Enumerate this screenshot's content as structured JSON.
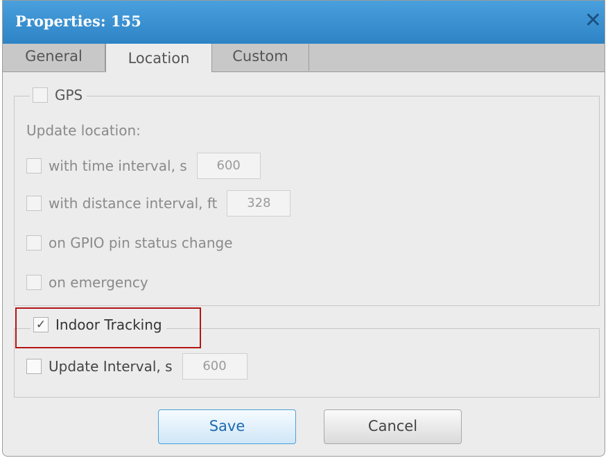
{
  "window": {
    "title": "Properties: 155",
    "close_glyph": "✕"
  },
  "tabs": [
    {
      "label": "General",
      "active": false
    },
    {
      "label": "Location",
      "active": true
    },
    {
      "label": "Custom",
      "active": false
    }
  ],
  "gps": {
    "label": "GPS",
    "checked": false,
    "update_location_label": "Update location:",
    "options": [
      {
        "label": "with time interval, s",
        "checked": false,
        "value": "600"
      },
      {
        "label": "with distance interval, ft",
        "checked": false,
        "value": "328"
      },
      {
        "label": "on GPIO pin status change",
        "checked": false
      },
      {
        "label": "on emergency",
        "checked": false
      }
    ]
  },
  "indoor": {
    "label": "Indoor Tracking",
    "checked": true,
    "check_glyph": "✓",
    "update_interval_label": "Update Interval, s",
    "update_interval_checked": false,
    "update_interval_value": "600"
  },
  "buttons": {
    "save": "Save",
    "cancel": "Cancel"
  },
  "colors": {
    "titlebar": "#2d83c4",
    "highlight": "#b31515",
    "save_text": "#1e6ab0"
  }
}
